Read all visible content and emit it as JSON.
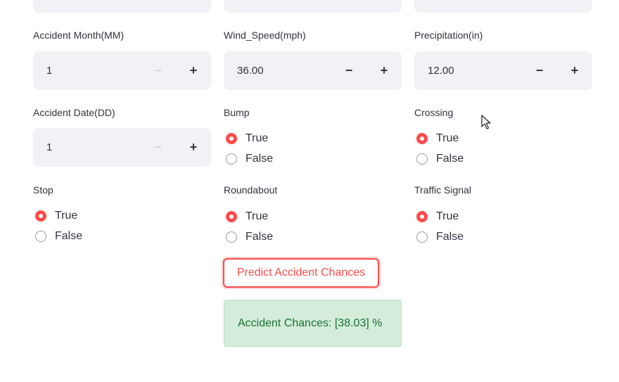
{
  "row_month": {
    "month": {
      "label": "Accident Month(MM)",
      "value": "1",
      "minus": "−",
      "plus": "+"
    },
    "wind": {
      "label": "Wind_Speed(mph)",
      "value": "36.00",
      "minus": "−",
      "plus": "+"
    },
    "precip": {
      "label": "Precipitation(in)",
      "value": "12.00",
      "minus": "−",
      "plus": "+"
    }
  },
  "row_date": {
    "date": {
      "label": "Accident Date(DD)",
      "value": "1",
      "minus": "−",
      "plus": "+"
    },
    "bump": {
      "label": "Bump",
      "options": [
        "True",
        "False"
      ],
      "selected": "True"
    },
    "crossing": {
      "label": "Crossing",
      "options": [
        "True",
        "False"
      ],
      "selected": "True"
    }
  },
  "row_stop": {
    "stop": {
      "label": "Stop",
      "options": [
        "True",
        "False"
      ],
      "selected": "True"
    },
    "roundabout": {
      "label": "Roundabout",
      "options": [
        "True",
        "False"
      ],
      "selected": "True"
    },
    "signal": {
      "label": "Traffic Signal",
      "options": [
        "True",
        "False"
      ],
      "selected": "True"
    }
  },
  "predict_button": "Predict Accident Chances",
  "result_text": "Accident Chances: [38.03] %",
  "colors": {
    "accent": "#ff4b4b",
    "success_bg": "#d4edda",
    "success_text": "#177233",
    "input_bg": "#f0f2f6"
  }
}
